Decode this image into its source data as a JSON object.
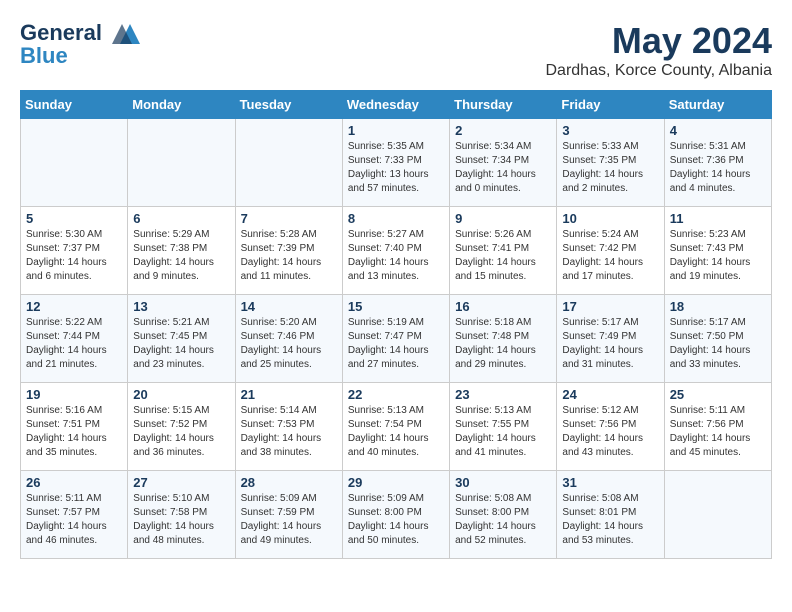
{
  "header": {
    "logo_line1": "General",
    "logo_line2": "Blue",
    "month_year": "May 2024",
    "location": "Dardhas, Korce County, Albania"
  },
  "days_of_week": [
    "Sunday",
    "Monday",
    "Tuesday",
    "Wednesday",
    "Thursday",
    "Friday",
    "Saturday"
  ],
  "weeks": [
    [
      {
        "day": "",
        "info": ""
      },
      {
        "day": "",
        "info": ""
      },
      {
        "day": "",
        "info": ""
      },
      {
        "day": "1",
        "info": "Sunrise: 5:35 AM\nSunset: 7:33 PM\nDaylight: 13 hours\nand 57 minutes."
      },
      {
        "day": "2",
        "info": "Sunrise: 5:34 AM\nSunset: 7:34 PM\nDaylight: 14 hours\nand 0 minutes."
      },
      {
        "day": "3",
        "info": "Sunrise: 5:33 AM\nSunset: 7:35 PM\nDaylight: 14 hours\nand 2 minutes."
      },
      {
        "day": "4",
        "info": "Sunrise: 5:31 AM\nSunset: 7:36 PM\nDaylight: 14 hours\nand 4 minutes."
      }
    ],
    [
      {
        "day": "5",
        "info": "Sunrise: 5:30 AM\nSunset: 7:37 PM\nDaylight: 14 hours\nand 6 minutes."
      },
      {
        "day": "6",
        "info": "Sunrise: 5:29 AM\nSunset: 7:38 PM\nDaylight: 14 hours\nand 9 minutes."
      },
      {
        "day": "7",
        "info": "Sunrise: 5:28 AM\nSunset: 7:39 PM\nDaylight: 14 hours\nand 11 minutes."
      },
      {
        "day": "8",
        "info": "Sunrise: 5:27 AM\nSunset: 7:40 PM\nDaylight: 14 hours\nand 13 minutes."
      },
      {
        "day": "9",
        "info": "Sunrise: 5:26 AM\nSunset: 7:41 PM\nDaylight: 14 hours\nand 15 minutes."
      },
      {
        "day": "10",
        "info": "Sunrise: 5:24 AM\nSunset: 7:42 PM\nDaylight: 14 hours\nand 17 minutes."
      },
      {
        "day": "11",
        "info": "Sunrise: 5:23 AM\nSunset: 7:43 PM\nDaylight: 14 hours\nand 19 minutes."
      }
    ],
    [
      {
        "day": "12",
        "info": "Sunrise: 5:22 AM\nSunset: 7:44 PM\nDaylight: 14 hours\nand 21 minutes."
      },
      {
        "day": "13",
        "info": "Sunrise: 5:21 AM\nSunset: 7:45 PM\nDaylight: 14 hours\nand 23 minutes."
      },
      {
        "day": "14",
        "info": "Sunrise: 5:20 AM\nSunset: 7:46 PM\nDaylight: 14 hours\nand 25 minutes."
      },
      {
        "day": "15",
        "info": "Sunrise: 5:19 AM\nSunset: 7:47 PM\nDaylight: 14 hours\nand 27 minutes."
      },
      {
        "day": "16",
        "info": "Sunrise: 5:18 AM\nSunset: 7:48 PM\nDaylight: 14 hours\nand 29 minutes."
      },
      {
        "day": "17",
        "info": "Sunrise: 5:17 AM\nSunset: 7:49 PM\nDaylight: 14 hours\nand 31 minutes."
      },
      {
        "day": "18",
        "info": "Sunrise: 5:17 AM\nSunset: 7:50 PM\nDaylight: 14 hours\nand 33 minutes."
      }
    ],
    [
      {
        "day": "19",
        "info": "Sunrise: 5:16 AM\nSunset: 7:51 PM\nDaylight: 14 hours\nand 35 minutes."
      },
      {
        "day": "20",
        "info": "Sunrise: 5:15 AM\nSunset: 7:52 PM\nDaylight: 14 hours\nand 36 minutes."
      },
      {
        "day": "21",
        "info": "Sunrise: 5:14 AM\nSunset: 7:53 PM\nDaylight: 14 hours\nand 38 minutes."
      },
      {
        "day": "22",
        "info": "Sunrise: 5:13 AM\nSunset: 7:54 PM\nDaylight: 14 hours\nand 40 minutes."
      },
      {
        "day": "23",
        "info": "Sunrise: 5:13 AM\nSunset: 7:55 PM\nDaylight: 14 hours\nand 41 minutes."
      },
      {
        "day": "24",
        "info": "Sunrise: 5:12 AM\nSunset: 7:56 PM\nDaylight: 14 hours\nand 43 minutes."
      },
      {
        "day": "25",
        "info": "Sunrise: 5:11 AM\nSunset: 7:56 PM\nDaylight: 14 hours\nand 45 minutes."
      }
    ],
    [
      {
        "day": "26",
        "info": "Sunrise: 5:11 AM\nSunset: 7:57 PM\nDaylight: 14 hours\nand 46 minutes."
      },
      {
        "day": "27",
        "info": "Sunrise: 5:10 AM\nSunset: 7:58 PM\nDaylight: 14 hours\nand 48 minutes."
      },
      {
        "day": "28",
        "info": "Sunrise: 5:09 AM\nSunset: 7:59 PM\nDaylight: 14 hours\nand 49 minutes."
      },
      {
        "day": "29",
        "info": "Sunrise: 5:09 AM\nSunset: 8:00 PM\nDaylight: 14 hours\nand 50 minutes."
      },
      {
        "day": "30",
        "info": "Sunrise: 5:08 AM\nSunset: 8:00 PM\nDaylight: 14 hours\nand 52 minutes."
      },
      {
        "day": "31",
        "info": "Sunrise: 5:08 AM\nSunset: 8:01 PM\nDaylight: 14 hours\nand 53 minutes."
      },
      {
        "day": "",
        "info": ""
      }
    ]
  ]
}
